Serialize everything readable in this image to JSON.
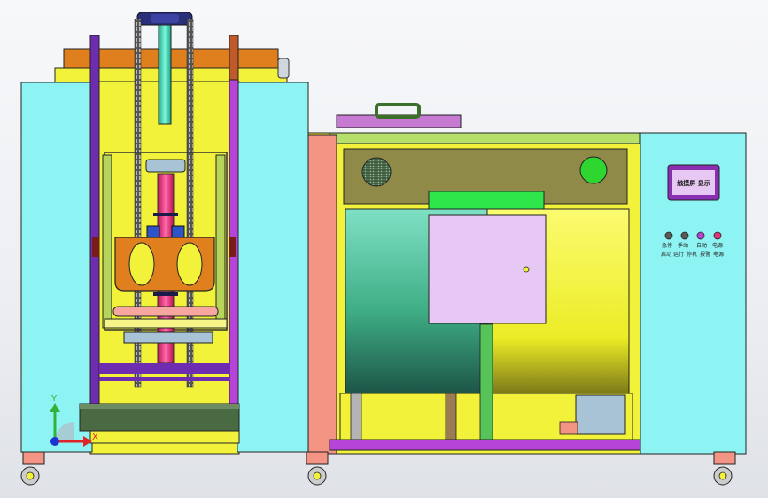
{
  "control_panel": {
    "display_label": "触摸屏 显示",
    "button_labels": [
      "急停",
      "手动",
      "自动",
      "电源",
      "启动"
    ],
    "bottom_labels": [
      "运行",
      "停机",
      "报警",
      "电源"
    ]
  },
  "triad": {
    "y_label": "Y",
    "x_label": "X"
  },
  "colors": {
    "cyan": "#8ef4f3",
    "yellow": "#f2f23a",
    "salmon": "#f49484",
    "lavender": "#e7c7f3",
    "green": "#2fe64a",
    "teal_drum": "#3fb98f",
    "olive": "#8f8a48",
    "orange": "#e07f1e",
    "magenta": "#e0367b",
    "purple": "#8a2fb2"
  }
}
